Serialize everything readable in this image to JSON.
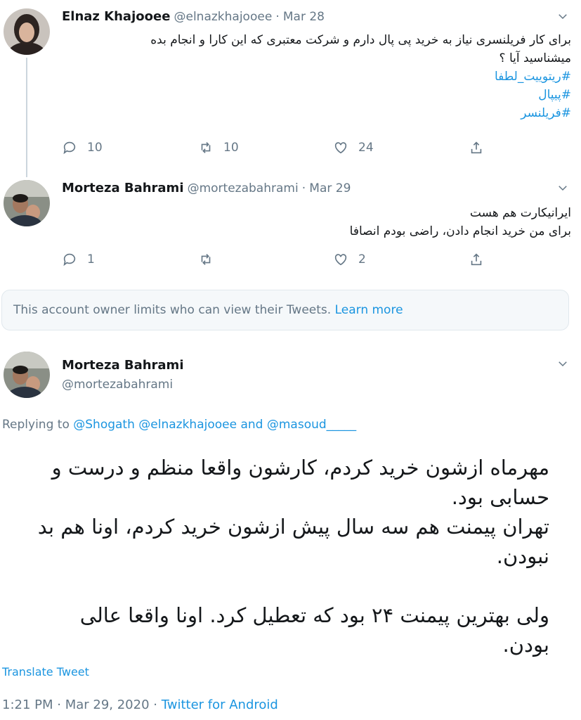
{
  "tweet1": {
    "name": "Elnaz Khajooee",
    "handle": "@elnazkhajooee",
    "date": "Mar 28",
    "text_line1": "برای کار فریلنسری نیاز به خرید پی پال دارم و شرکت معتبری که این کارا و انجام بده",
    "text_line2": "میشناسید آیا ؟",
    "hashtags": [
      "#ریتوییت_لطفا",
      "#پیپال",
      "#فریلنسر"
    ],
    "replies": "10",
    "retweets": "10",
    "likes": "24"
  },
  "tweet2": {
    "name": "Morteza Bahrami",
    "handle": "@mortezabahrami",
    "date": "Mar 29",
    "text_line1": "ایرانیکارت هم هست",
    "text_line2": "برای من خرید انجام دادن، راضی بودم انصافا",
    "replies": "1",
    "retweets": "",
    "likes": "2"
  },
  "notice": {
    "text": "This account owner limits who can view their Tweets.",
    "link": "Learn more"
  },
  "main_tweet": {
    "name": "Morteza Bahrami",
    "handle": "@mortezabahrami",
    "replying_prefix": "Replying to",
    "replying_to_1": "@Shogath",
    "replying_to_2": "@elnazkhajooee",
    "replying_and": "and",
    "replying_to_3": "@masoud_____",
    "lines": [
      "مهرماه ازشون خرید کردم، کارشون واقعا منظم و درست و",
      "حسابی بود.",
      "تهران پیمنت هم سه سال پیش ازشون خرید کردم، اونا هم بد",
      "نبودن.",
      "ولی بهترین پیمنت ۲۴ بود که تعطیل کرد. اونا واقعا عالی",
      "بودن."
    ],
    "translate": "Translate Tweet",
    "time_date": "1:21 PM · Mar 29, 2020 ·",
    "source": "Twitter for Android"
  },
  "colors": {
    "accent": "#1b95e0",
    "muted": "#657786",
    "text": "#14171a"
  }
}
